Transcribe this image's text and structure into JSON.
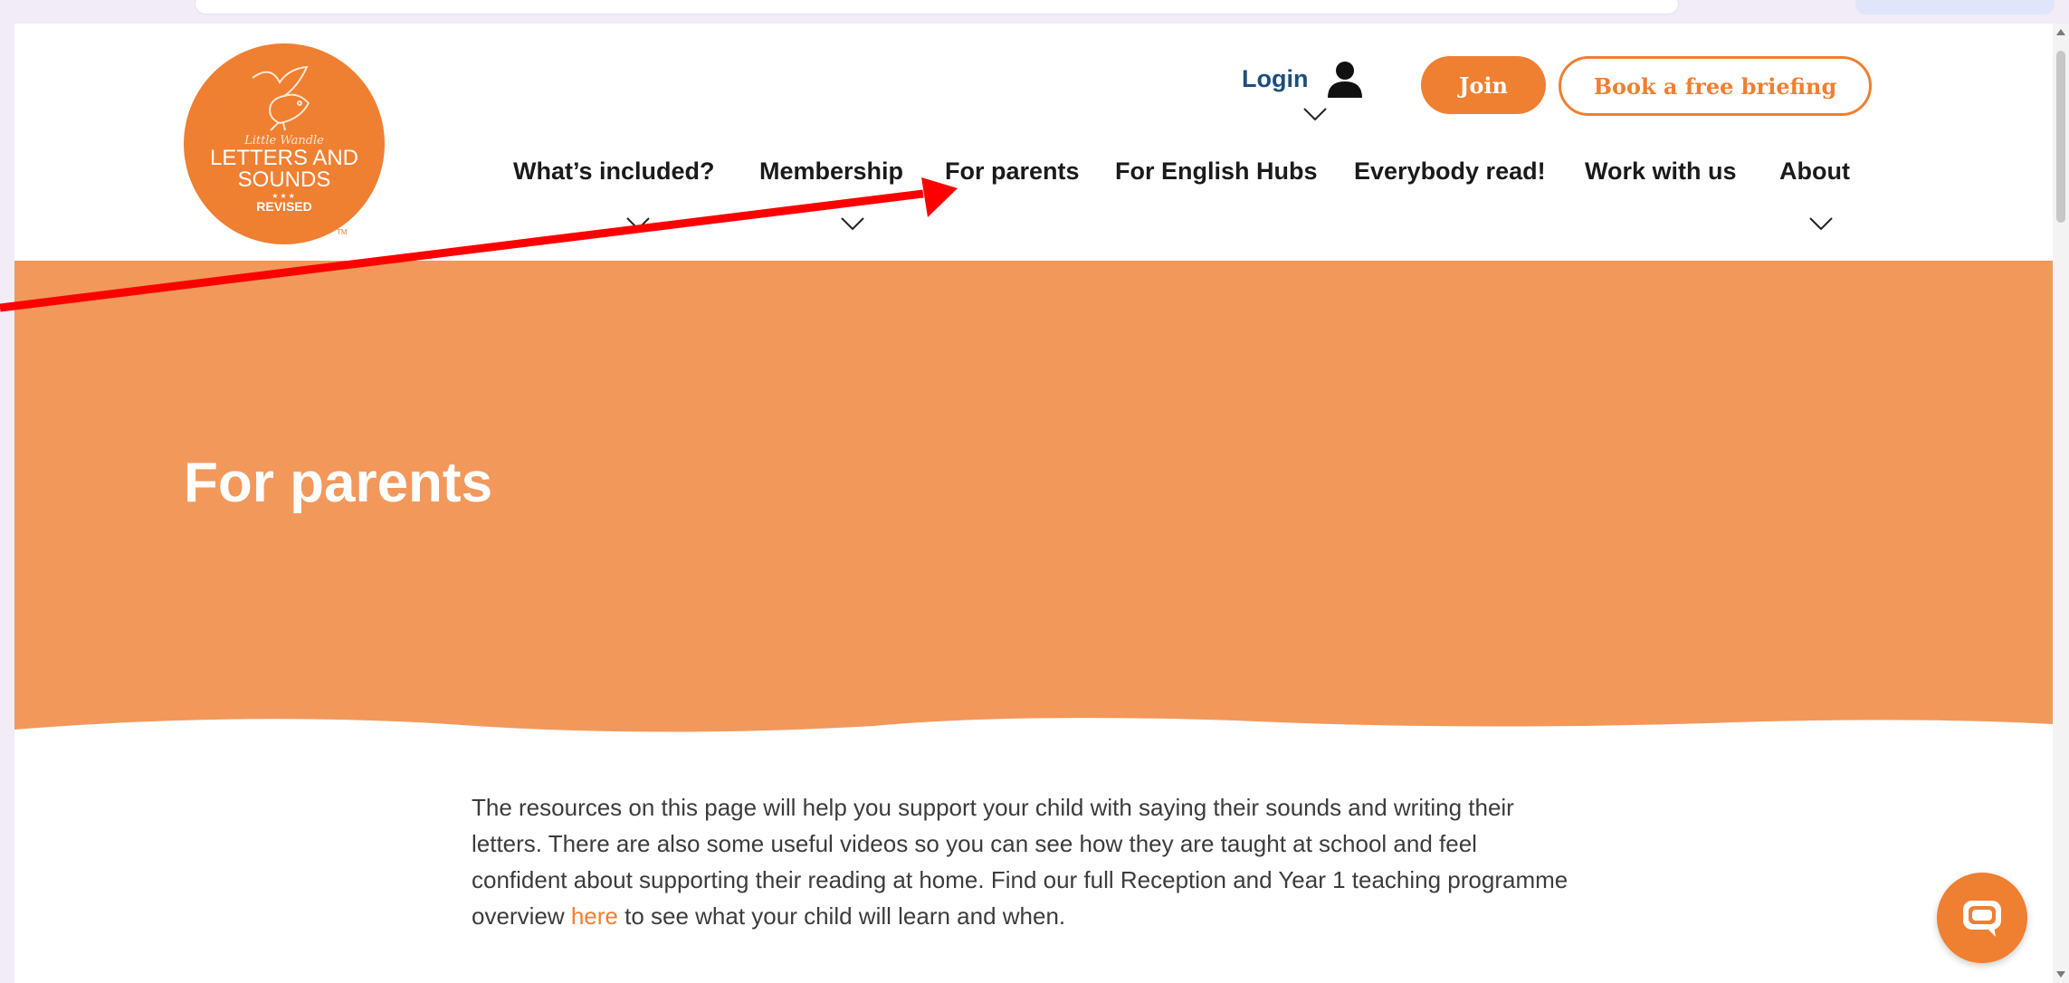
{
  "logo": {
    "script_text": "Little Wandle",
    "line1": "LETTERS AND",
    "line2": "SOUNDS",
    "badge": "REVISED",
    "trademark": "TM"
  },
  "header": {
    "login_label": "Login",
    "join_label": "Join",
    "briefing_label": "Book a free briefing"
  },
  "nav": {
    "items": [
      {
        "label": "What’s included?",
        "has_dropdown": true
      },
      {
        "label": "Membership",
        "has_dropdown": true
      },
      {
        "label": "For parents",
        "has_dropdown": false
      },
      {
        "label": "For English Hubs",
        "has_dropdown": false
      },
      {
        "label": "Everybody read!",
        "has_dropdown": false
      },
      {
        "label": "Work with us",
        "has_dropdown": false
      },
      {
        "label": "About",
        "has_dropdown": true
      }
    ]
  },
  "hero": {
    "title": "For parents"
  },
  "intro": {
    "text_before_link": "The resources on this page will help you support your child with saying their sounds and writing their letters. There are also some useful videos so you can see how they are taught at school and feel confident about supporting their reading at home. Find our full Reception and Year 1 teaching programme overview ",
    "link_text": "here",
    "text_after_link": " to see what your child will learn and when."
  },
  "colors": {
    "brand_orange": "#ef7f31",
    "hero_orange": "#f2985b",
    "login_blue": "#1d4e7a",
    "annotation_red": "#ff0000"
  },
  "icons": [
    "user-icon",
    "chevron-down-icon",
    "chat-icon",
    "bird-logo-icon"
  ]
}
